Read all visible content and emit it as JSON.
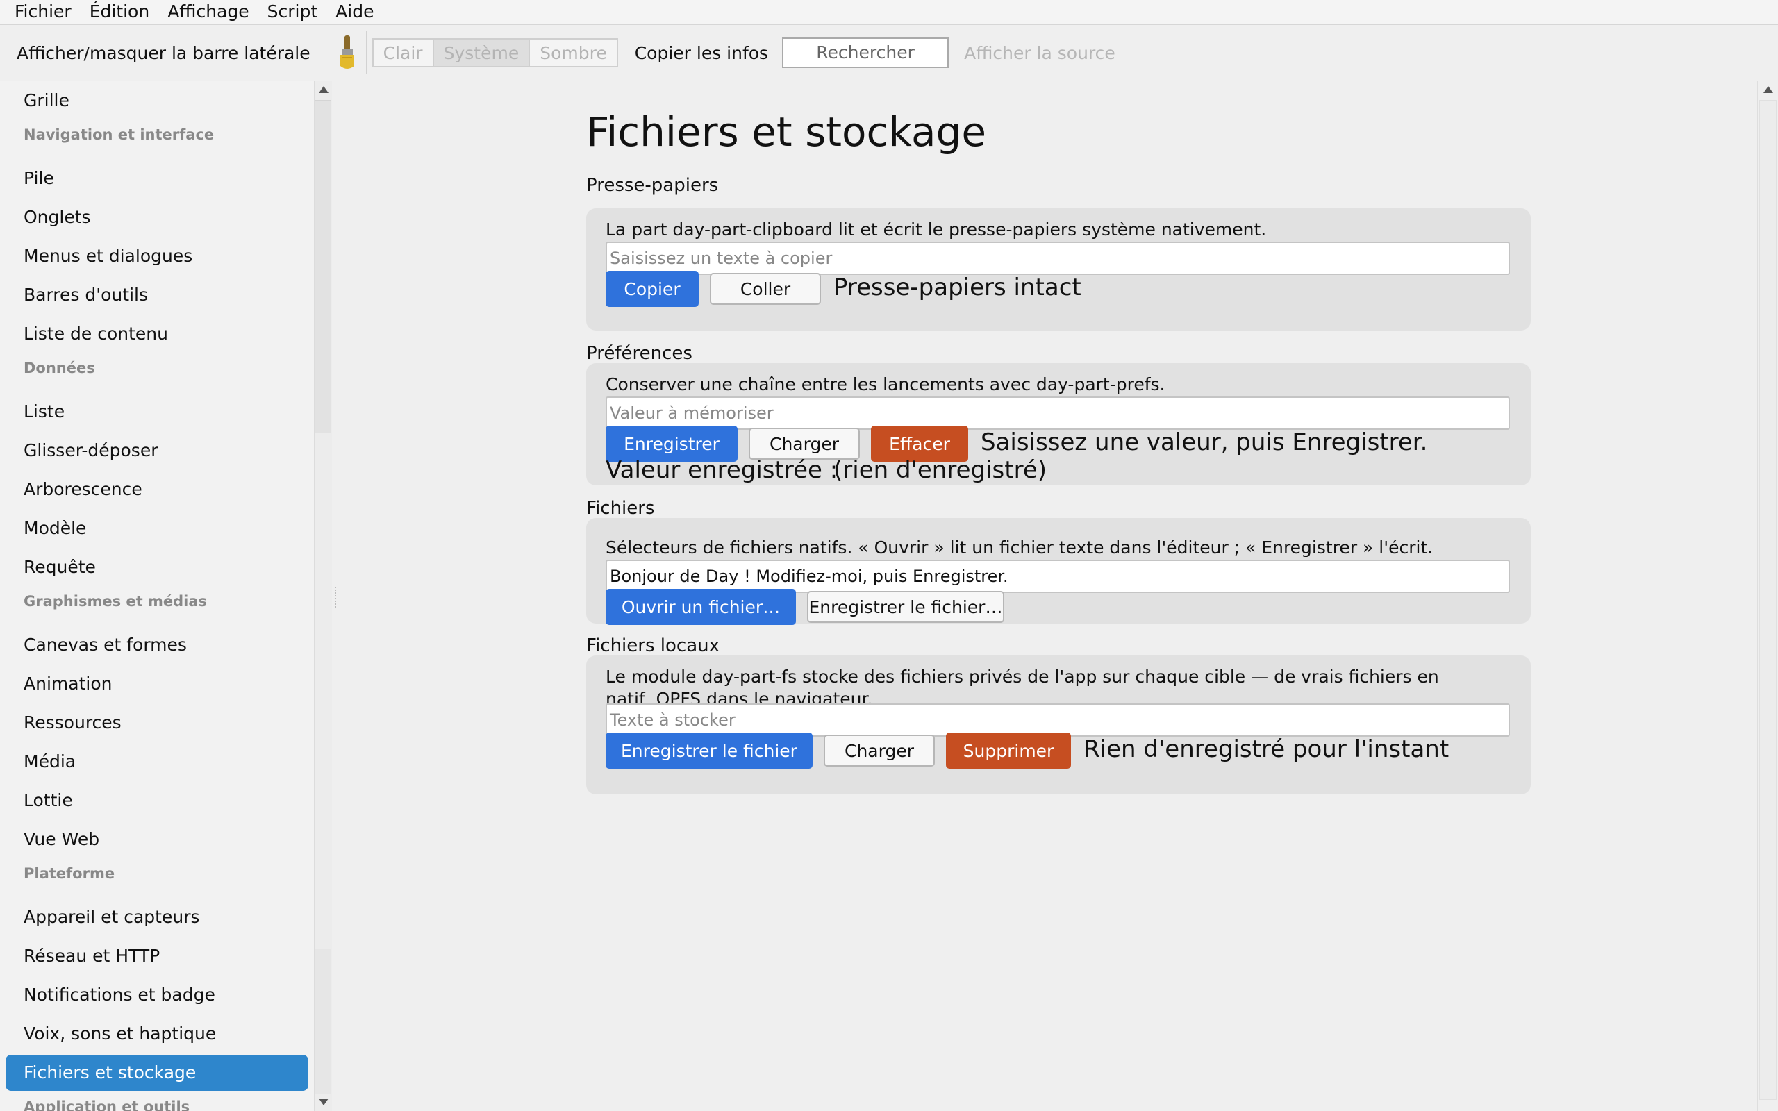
{
  "menu": [
    "Fichier",
    "Édition",
    "Affichage",
    "Script",
    "Aide"
  ],
  "toolbar": {
    "toggle_sidebar": "Afficher/masquer la barre latérale",
    "theme": [
      "Clair",
      "Système",
      "Sombre"
    ],
    "theme_selected": "Système",
    "copy_info": "Copier les infos",
    "search": "Rechercher",
    "view_source": "Afficher la source"
  },
  "sidebar": {
    "items": [
      {
        "type": "item",
        "label": "Grille"
      },
      {
        "type": "header",
        "label": "Navigation et interface"
      },
      {
        "type": "item",
        "label": "Pile"
      },
      {
        "type": "item",
        "label": "Onglets"
      },
      {
        "type": "item",
        "label": "Menus et dialogues"
      },
      {
        "type": "item",
        "label": "Barres d'outils"
      },
      {
        "type": "item",
        "label": "Liste de contenu"
      },
      {
        "type": "header",
        "label": "Données"
      },
      {
        "type": "item",
        "label": "Liste"
      },
      {
        "type": "item",
        "label": "Glisser-déposer"
      },
      {
        "type": "item",
        "label": "Arborescence"
      },
      {
        "type": "item",
        "label": "Modèle"
      },
      {
        "type": "item",
        "label": "Requête"
      },
      {
        "type": "header",
        "label": "Graphismes et médias"
      },
      {
        "type": "item",
        "label": "Canevas et formes"
      },
      {
        "type": "item",
        "label": "Animation"
      },
      {
        "type": "item",
        "label": "Ressources"
      },
      {
        "type": "item",
        "label": "Média"
      },
      {
        "type": "item",
        "label": "Lottie"
      },
      {
        "type": "item",
        "label": "Vue Web"
      },
      {
        "type": "header",
        "label": "Plateforme"
      },
      {
        "type": "item",
        "label": "Appareil et capteurs"
      },
      {
        "type": "item",
        "label": "Réseau et HTTP"
      },
      {
        "type": "item",
        "label": "Notifications et badge"
      },
      {
        "type": "item",
        "label": "Voix, sons et haptique"
      },
      {
        "type": "item",
        "label": "Fichiers et stockage",
        "selected": true
      },
      {
        "type": "header",
        "label": "Application et outils"
      }
    ]
  },
  "main": {
    "title": "Fichiers et stockage",
    "clipboard": {
      "title": "Presse-papiers",
      "desc": "La part day-part-clipboard lit et écrit le presse-papiers système nativement.",
      "placeholder": "Saisissez un texte à copier",
      "copy": "Copier",
      "paste": "Coller",
      "status": "Presse-papiers intact"
    },
    "prefs": {
      "title": "Préférences",
      "desc": "Conserver une chaîne entre les lancements avec day-part-prefs.",
      "placeholder": "Valeur à mémoriser",
      "save": "Enregistrer",
      "load": "Charger",
      "clear": "Effacer",
      "status": "Saisissez une valeur, puis Enregistrer.",
      "saved_label": "Valeur enregistrée :",
      "saved_value": "(rien d'enregistré)"
    },
    "files": {
      "title": "Fichiers",
      "desc": "Sélecteurs de fichiers natifs. « Ouvrir » lit un fichier texte dans l'éditeur ; « Enregistrer » l'écrit.",
      "value": "Bonjour de Day ! Modifiez-moi, puis Enregistrer.",
      "open": "Ouvrir un fichier…",
      "save": "Enregistrer le fichier…"
    },
    "local_files": {
      "title": "Fichiers locaux",
      "desc_line1": "Le module day-part-fs stocke des fichiers privés de l'app sur chaque cible — de vrais fichiers en",
      "desc_line2": "natif, OPFS dans le navigateur.",
      "placeholder": "Texte à stocker",
      "save": "Enregistrer le fichier",
      "load": "Charger",
      "delete": "Supprimer",
      "status": "Rien d'enregistré pour l'instant"
    }
  }
}
